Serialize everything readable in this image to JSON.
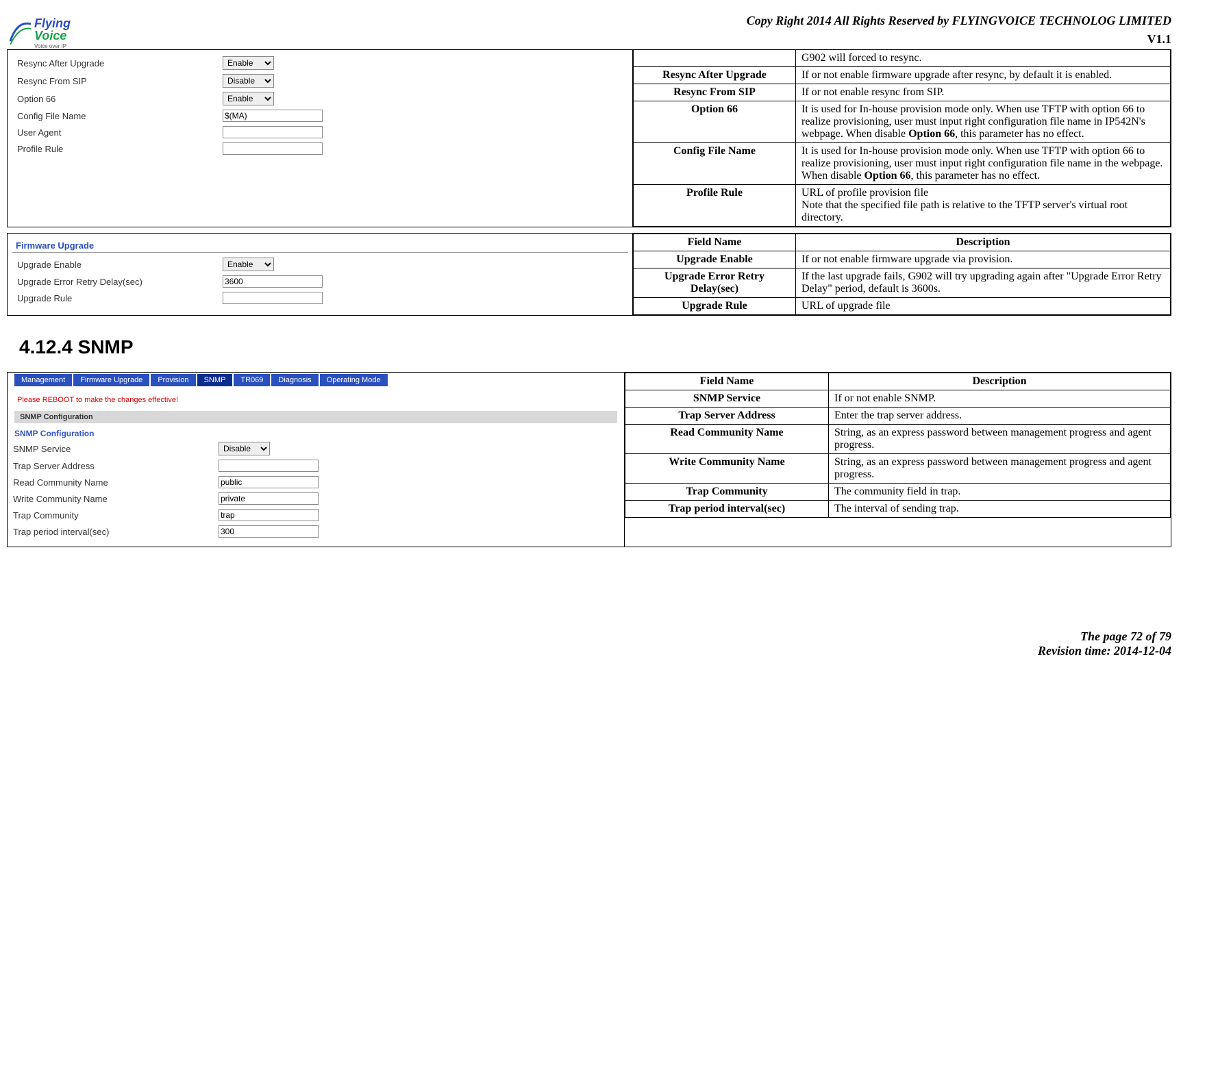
{
  "header": {
    "copyright": "Copy Right 2014 All Rights Reserved by FLYINGVOICE TECHNOLOG LIMITED",
    "version": "V1.1"
  },
  "logo": {
    "line1": "Flying",
    "line2": "Voice",
    "tag": "Voice over IP"
  },
  "block1": {
    "form": {
      "rows": [
        {
          "label": "Resync After Upgrade",
          "type": "select",
          "value": "Enable"
        },
        {
          "label": "Resync From SIP",
          "type": "select",
          "value": "Disable"
        },
        {
          "label": "Option 66",
          "type": "select",
          "value": "Enable"
        },
        {
          "label": "Config File Name",
          "type": "text",
          "value": "$(MA)"
        },
        {
          "label": "User Agent",
          "type": "text",
          "value": ""
        },
        {
          "label": "Profile Rule",
          "type": "text",
          "value": ""
        }
      ]
    },
    "desc_top_cell": "G902 will forced to resync.",
    "rows": [
      {
        "name": "Resync After Upgrade",
        "desc": "If or not enable firmware upgrade after resync, by default it is enabled."
      },
      {
        "name": "Resync From SIP",
        "desc": "If or not enable resync from SIP."
      },
      {
        "name": "Option 66",
        "desc_parts": [
          "It is used for In-house provision mode only. When use TFTP with option 66 to realize provisioning, user must input right configuration file name in IP542N's webpage. When disable ",
          "Option 66",
          ", this parameter has no effect."
        ]
      },
      {
        "name": "Config File Name",
        "desc_parts": [
          "It is used for In-house provision mode only. When use TFTP with option 66 to realize provisioning, user must input right configuration file name in the webpage. When disable ",
          "Option 66",
          ", this parameter has no effect."
        ]
      },
      {
        "name": "Profile Rule",
        "desc": "URL of profile provision file\nNote that the specified file path is relative to the TFTP server's virtual root directory."
      }
    ]
  },
  "block2": {
    "section_title": "Firmware Upgrade",
    "form": {
      "rows": [
        {
          "label": "Upgrade Enable",
          "type": "select",
          "value": "Enable"
        },
        {
          "label": "Upgrade Error Retry Delay(sec)",
          "type": "text",
          "value": "3600"
        },
        {
          "label": "Upgrade Rule",
          "type": "text",
          "value": ""
        }
      ]
    },
    "headers": {
      "field": "Field Name",
      "desc": "Description"
    },
    "rows": [
      {
        "name": "Upgrade Enable",
        "desc": "If or not enable firmware upgrade via provision."
      },
      {
        "name": "Upgrade Error Retry Delay(sec)",
        "desc": "If the last upgrade fails, G902 will try upgrading again after \"Upgrade Error Retry Delay\" period, default is 3600s."
      },
      {
        "name": "Upgrade Rule",
        "desc": "URL of upgrade file"
      }
    ]
  },
  "heading_snmp": "4.12.4  SNMP",
  "block3": {
    "tabs": [
      "Management",
      "Firmware Upgrade",
      "Provision",
      "SNMP",
      "TR069",
      "Diagnosis",
      "Operating Mode"
    ],
    "active_tab": "SNMP",
    "reboot_msg": "Please REBOOT to make the changes effective!",
    "gray_band": "SNMP Configuration",
    "subsection": "SNMP Configuration",
    "form": {
      "rows": [
        {
          "label": "SNMP Service",
          "type": "select",
          "value": "Disable"
        },
        {
          "label": "Trap Server Address",
          "type": "text",
          "value": ""
        },
        {
          "label": "Read Community Name",
          "type": "text",
          "value": "public"
        },
        {
          "label": "Write Community Name",
          "type": "text",
          "value": "private"
        },
        {
          "label": "Trap Community",
          "type": "text",
          "value": "trap"
        },
        {
          "label": "Trap period interval(sec)",
          "type": "text",
          "value": "300"
        }
      ]
    },
    "headers": {
      "field": "Field Name",
      "desc": "Description"
    },
    "rows": [
      {
        "name": "SNMP Service",
        "desc": "If or not enable SNMP."
      },
      {
        "name": "Trap Server Address",
        "desc": "Enter the trap server address."
      },
      {
        "name": "Read Community Name",
        "desc": "String, as an express password between management progress and agent progress."
      },
      {
        "name": "Write Community Name",
        "desc": "String, as an express password between management progress and agent progress."
      },
      {
        "name": "Trap Community",
        "desc": "The community field in trap."
      },
      {
        "name": "Trap period interval(sec)",
        "desc": "The interval of sending trap."
      }
    ]
  },
  "footer": {
    "page": "The page 72 of 79",
    "revision": "Revision time: 2014-12-04"
  }
}
